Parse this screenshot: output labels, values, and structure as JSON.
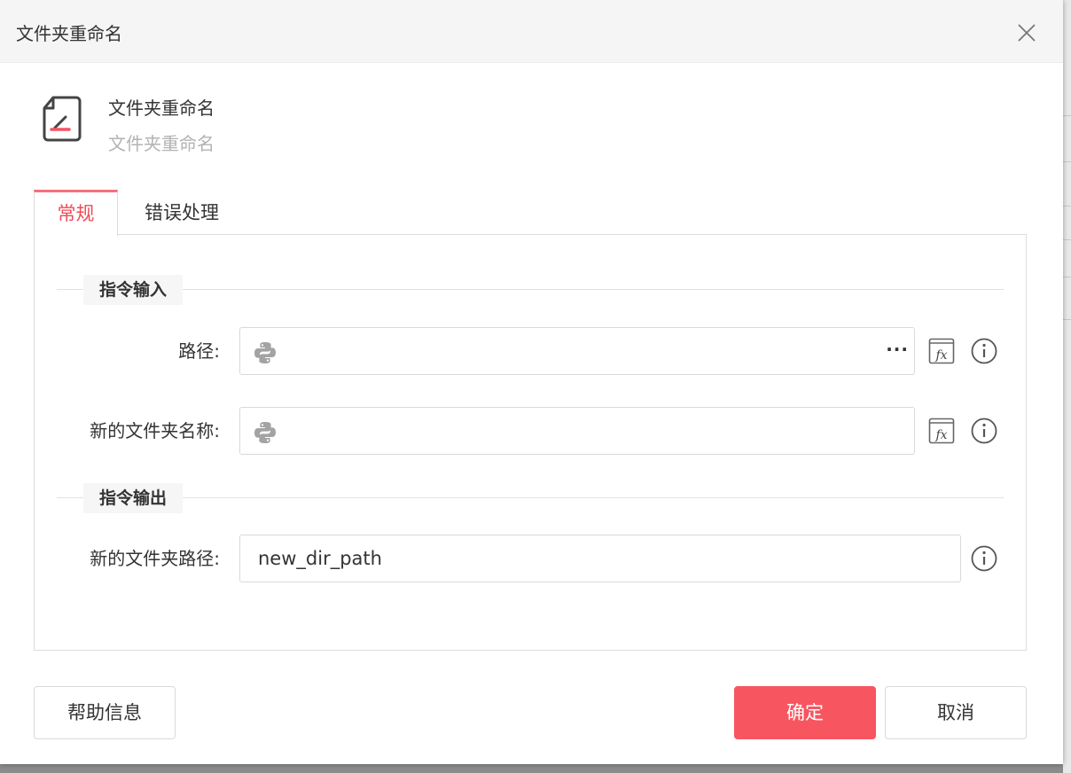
{
  "dialog": {
    "title": "文件夹重命名",
    "close_icon": "close-icon"
  },
  "header": {
    "icon": "document-edit-icon",
    "title": "文件夹重命名",
    "subtitle": "文件夹重命名"
  },
  "tabs": [
    {
      "label": "常规",
      "active": true
    },
    {
      "label": "错误处理",
      "active": false
    }
  ],
  "sections": {
    "input": {
      "title": "指令输入"
    },
    "output": {
      "title": "指令输出"
    }
  },
  "fields": {
    "path": {
      "label": "路径:",
      "value": "",
      "has_ellipsis": true
    },
    "new_name": {
      "label": "新的文件夹名称:",
      "value": ""
    },
    "new_path": {
      "label": "新的文件夹路径:",
      "value": "new_dir_path"
    }
  },
  "ellipsis_label": "···",
  "buttons": {
    "help": "帮助信息",
    "ok": "确定",
    "cancel": "取消"
  },
  "colors": {
    "accent": "#f75560",
    "tab_active_text": "#ee4c58"
  }
}
